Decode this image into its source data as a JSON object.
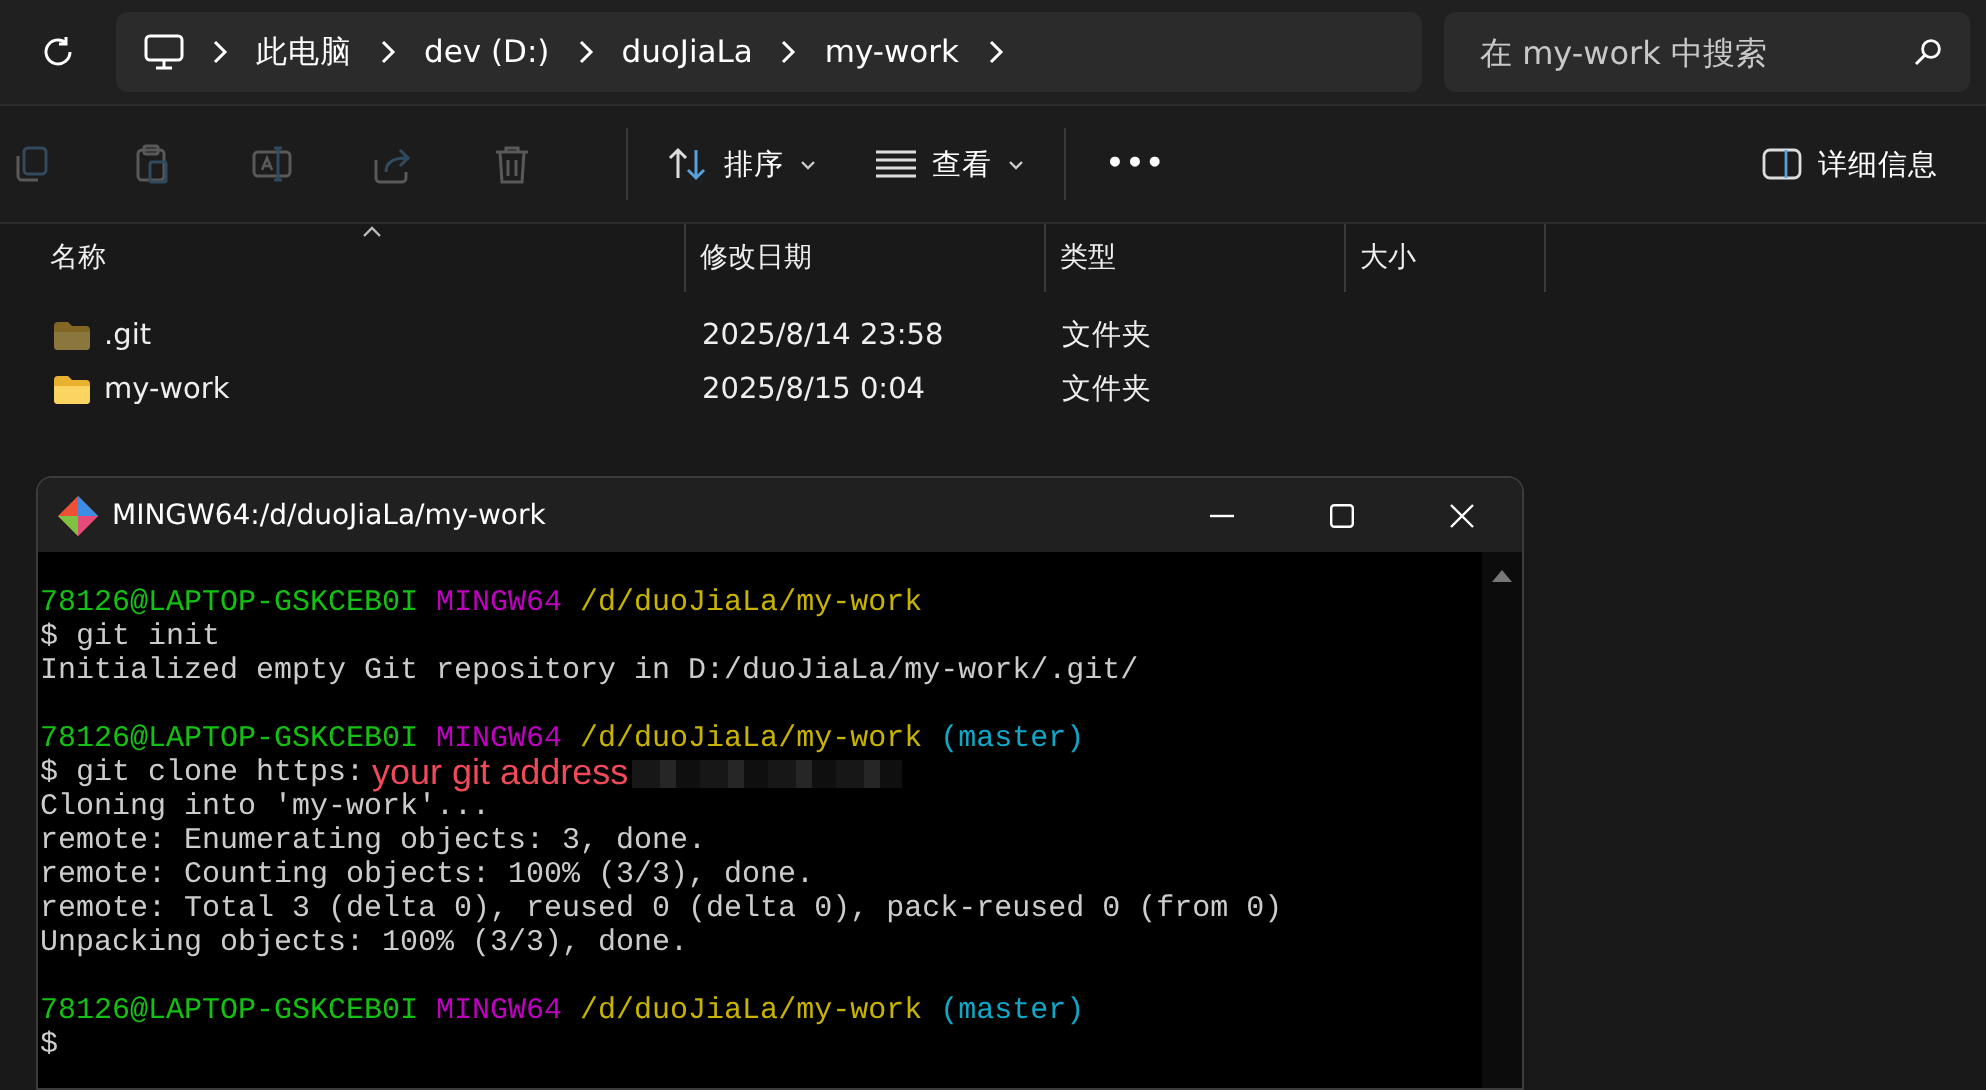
{
  "explorer": {
    "breadcrumb": [
      "此电脑",
      "dev (D:)",
      "duoJiaLa",
      "my-work"
    ],
    "search": {
      "placeholder": "在 my-work 中搜索"
    },
    "toolbar": [
      {
        "kind": "copy",
        "disabled": true
      },
      {
        "kind": "paste",
        "disabled": true
      },
      {
        "kind": "rename",
        "disabled": true
      },
      {
        "kind": "share",
        "disabled": true
      },
      {
        "kind": "delete",
        "disabled": true
      }
    ],
    "sort_button": {
      "label": "排序"
    },
    "view_button": {
      "label": "查看"
    },
    "more_button": {
      "label": "•••"
    },
    "details_button": {
      "label": "详细信息"
    },
    "columns": [
      {
        "label": "名称",
        "sorted": true
      },
      {
        "label": "修改日期",
        "sorted": false
      },
      {
        "label": "类型",
        "sorted": false
      },
      {
        "label": "大小",
        "sorted": false
      }
    ],
    "rows": [
      {
        "name": ".git",
        "modified": "2025/8/14 23:58",
        "type": "文件夹",
        "hidden": true
      },
      {
        "name": "my-work",
        "modified": "2025/8/15 0:04",
        "type": "文件夹",
        "hidden": false
      }
    ]
  },
  "terminal": {
    "title": "MINGW64:/d/duoJiaLa/my-work",
    "lines": [
      {
        "segments": [
          {
            "kind": "user",
            "text": "78126@LAPTOP-GSKCEB0I"
          },
          {
            "kind": "host",
            "text": "MINGW64"
          },
          {
            "kind": "path",
            "text": "/d/duoJiaLa/my-work"
          }
        ]
      },
      {
        "segments": [
          {
            "kind": "plain",
            "text": "$ git init"
          }
        ]
      },
      {
        "segments": [
          {
            "kind": "plain",
            "text": "Initialized empty Git repository in D:/duoJiaLa/my-work/.git/"
          }
        ]
      },
      {
        "kind": "blank"
      },
      {
        "segments": [
          {
            "kind": "user",
            "text": "78126@LAPTOP-GSKCEB0I"
          },
          {
            "kind": "host",
            "text": "MINGW64"
          },
          {
            "kind": "path",
            "text": "/d/duoJiaLa/my-work"
          },
          {
            "kind": "branch",
            "text": "(master)"
          }
        ]
      },
      {
        "segments": [
          {
            "kind": "plain",
            "text": "$ git clone https:"
          },
          {
            "kind": "annotation",
            "text": "your git address"
          },
          {
            "kind": "redacted"
          }
        ]
      },
      {
        "segments": [
          {
            "kind": "plain",
            "text": "Cloning into 'my-work'..."
          }
        ]
      },
      {
        "segments": [
          {
            "kind": "plain",
            "text": "remote: Enumerating objects: 3, done."
          }
        ]
      },
      {
        "segments": [
          {
            "kind": "plain",
            "text": "remote: Counting objects: 100% (3/3), done."
          }
        ]
      },
      {
        "segments": [
          {
            "kind": "plain",
            "text": "remote: Total 3 (delta 0), reused 0 (delta 0), pack-reused 0 (from 0)"
          }
        ]
      },
      {
        "segments": [
          {
            "kind": "plain",
            "text": "Unpacking objects: 100% (3/3), done."
          }
        ]
      },
      {
        "kind": "blank"
      },
      {
        "segments": [
          {
            "kind": "user",
            "text": "78126@LAPTOP-GSKCEB0I"
          },
          {
            "kind": "host",
            "text": "MINGW64"
          },
          {
            "kind": "path",
            "text": "/d/duoJiaLa/my-work"
          },
          {
            "kind": "branch",
            "text": "(master)"
          }
        ]
      },
      {
        "segments": [
          {
            "kind": "plain",
            "text": "$"
          }
        ]
      }
    ]
  }
}
